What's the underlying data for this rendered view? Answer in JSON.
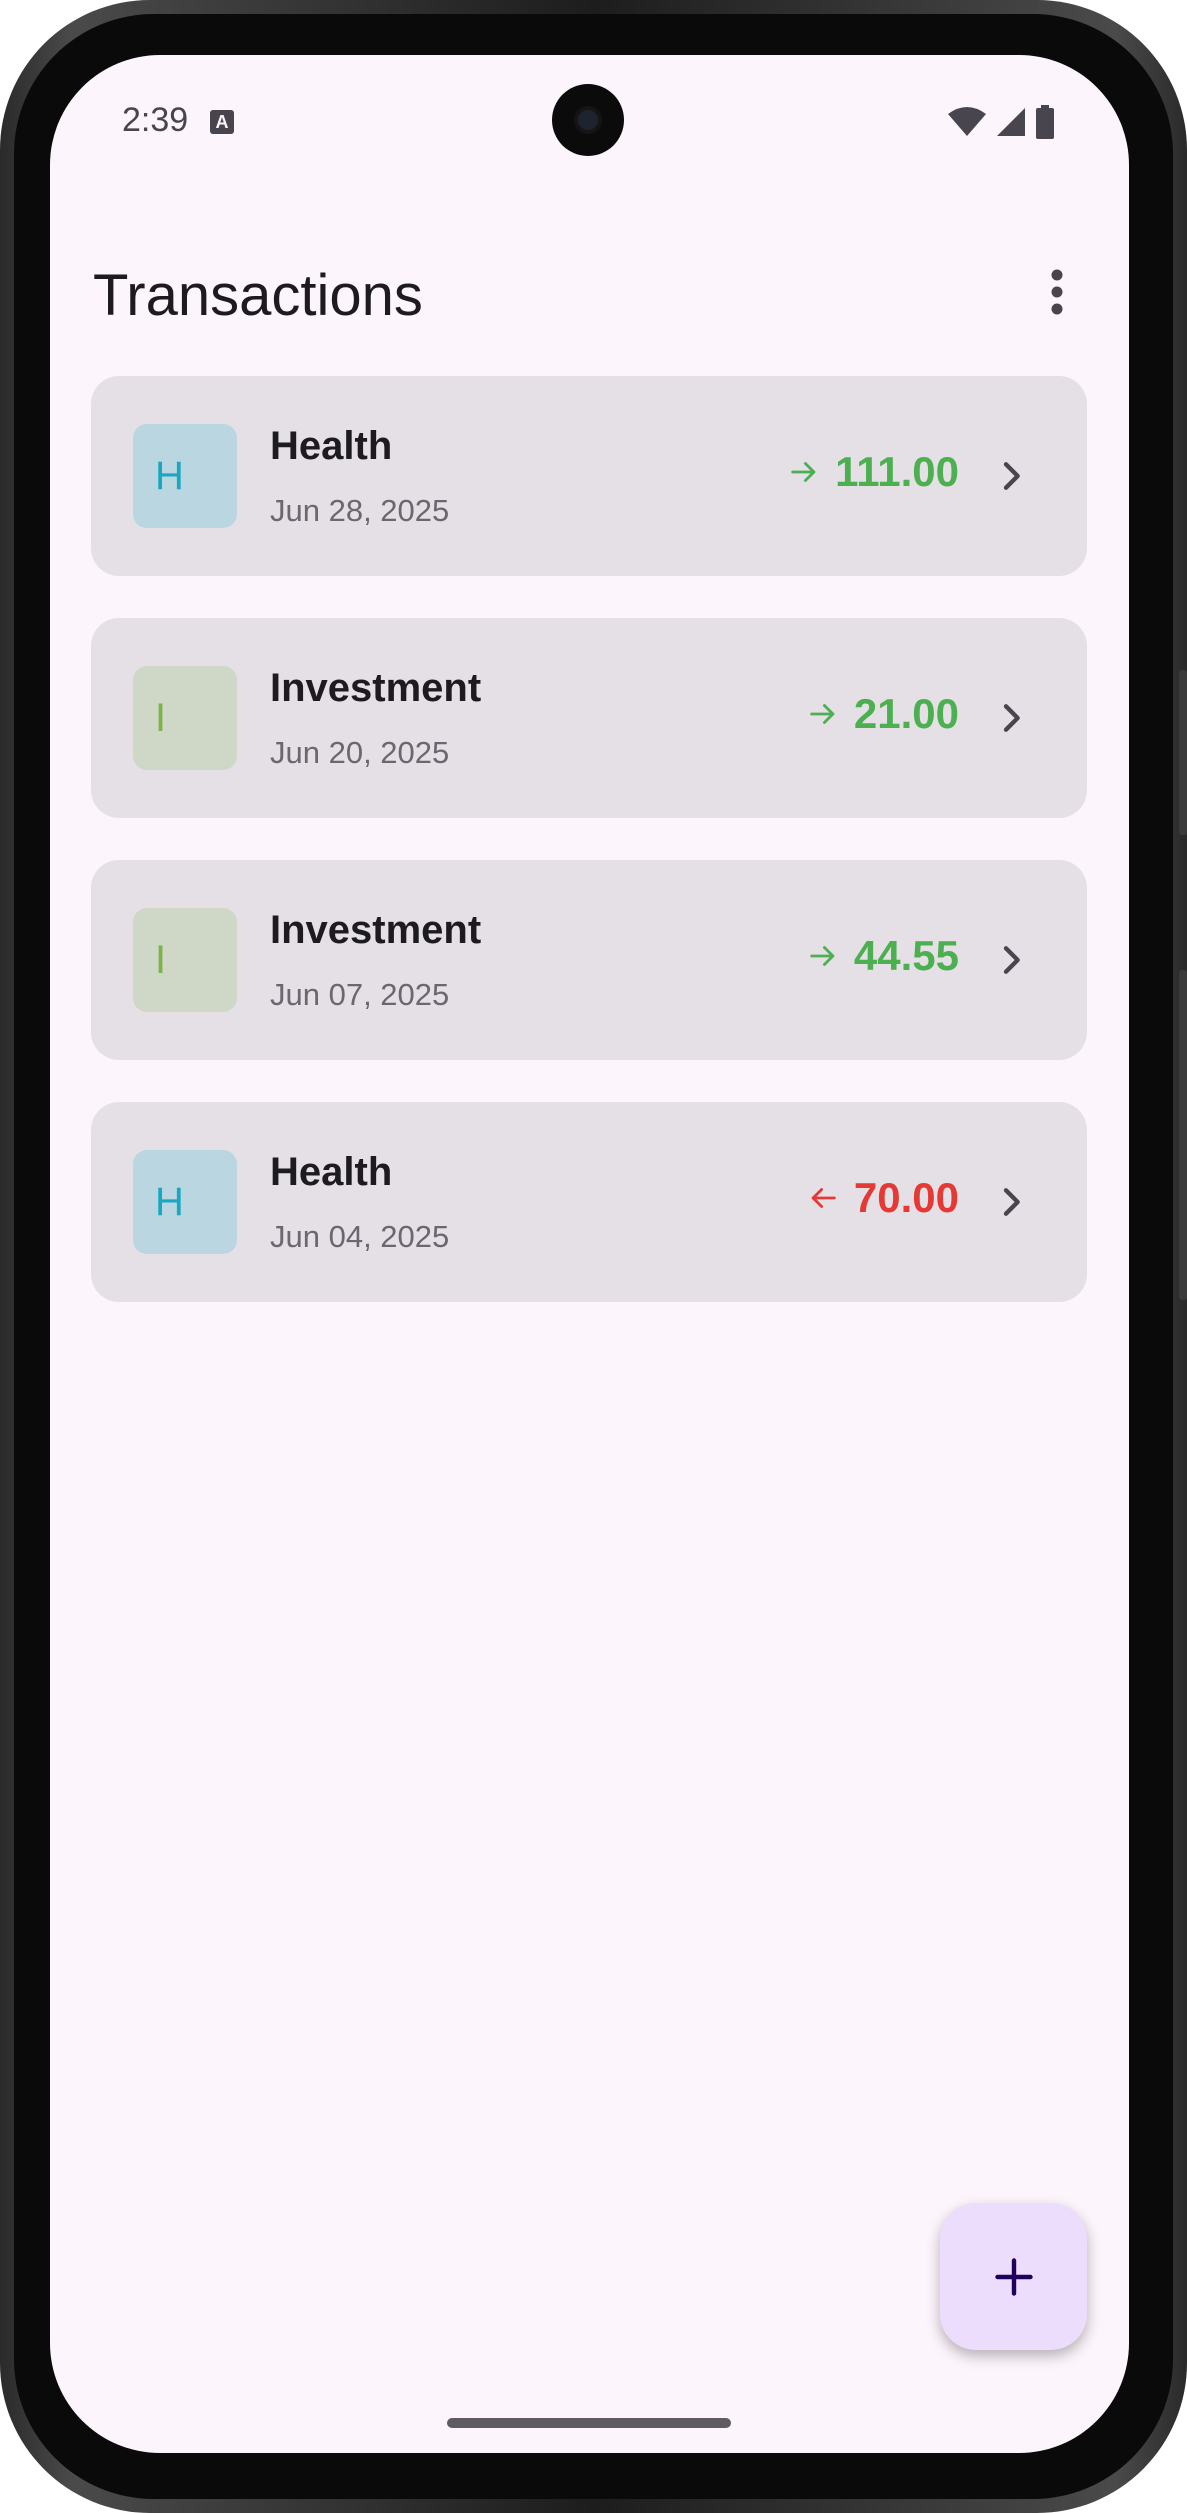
{
  "status_bar": {
    "time": "2:39",
    "notification_icon": "A"
  },
  "app_bar": {
    "title": "Transactions",
    "menu_icon": "more-vert-icon"
  },
  "transactions": [
    {
      "initial": "H",
      "category": "Health",
      "date": "Jun 28, 2025",
      "direction": "in",
      "amount": "111.00"
    },
    {
      "initial": "I",
      "category": "Investment",
      "date": "Jun 20, 2025",
      "direction": "in",
      "amount": "21.00"
    },
    {
      "initial": "I",
      "category": "Investment",
      "date": "Jun 07, 2025",
      "direction": "in",
      "amount": "44.55"
    },
    {
      "initial": "H",
      "category": "Health",
      "date": "Jun 04, 2025",
      "direction": "out",
      "amount": "70.00"
    }
  ],
  "colors": {
    "background": "#fcf5fb",
    "card": "#e5e0e6",
    "income": "#4caf50",
    "expense": "#e53935",
    "health_avatar_bg": "#b9d6e1",
    "health_avatar_fg": "#1aa8c0",
    "investment_avatar_bg": "#cfd7c6",
    "investment_avatar_fg": "#7cb342",
    "fab": "#ebddfb"
  },
  "fab": {
    "icon": "plus-icon"
  }
}
